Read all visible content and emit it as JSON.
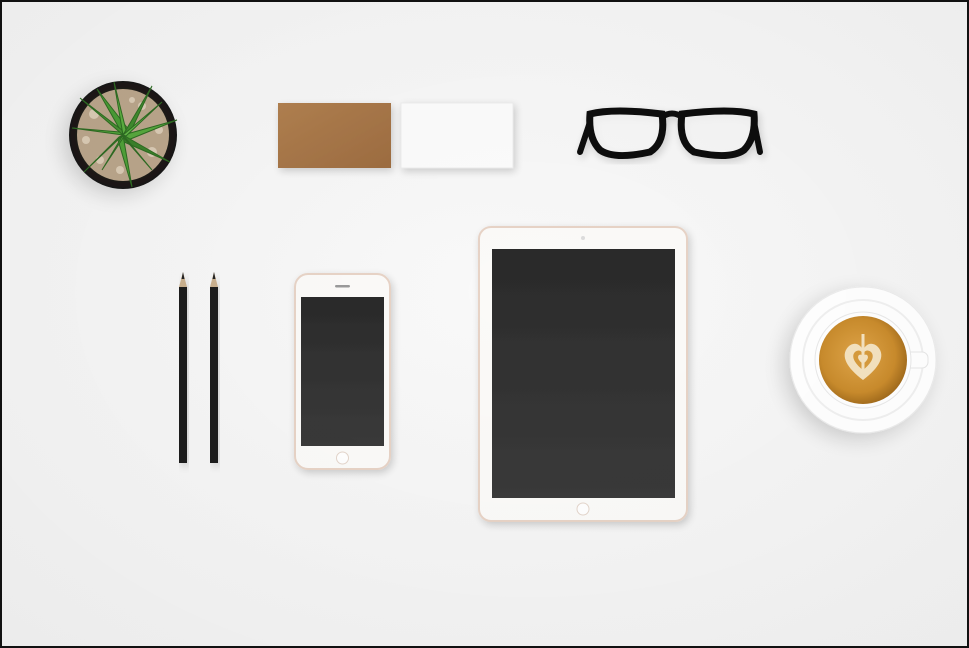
{
  "scene": {
    "objects": [
      "succulent-plant",
      "kraft-business-card",
      "white-business-card",
      "eyeglasses",
      "pencil",
      "pencil",
      "smartphone",
      "tablet",
      "latte-cup"
    ]
  },
  "colors": {
    "background": "#f6f6f6",
    "border": "#111111",
    "kraft_card": "#a8784a",
    "screen": "#2e2e2e",
    "device_body": "#fbfaf8",
    "device_rim": "#e7d3c6",
    "latte": "#c68a2c",
    "foam": "#f4e2bf",
    "plant_green": "#3f8a2e"
  }
}
